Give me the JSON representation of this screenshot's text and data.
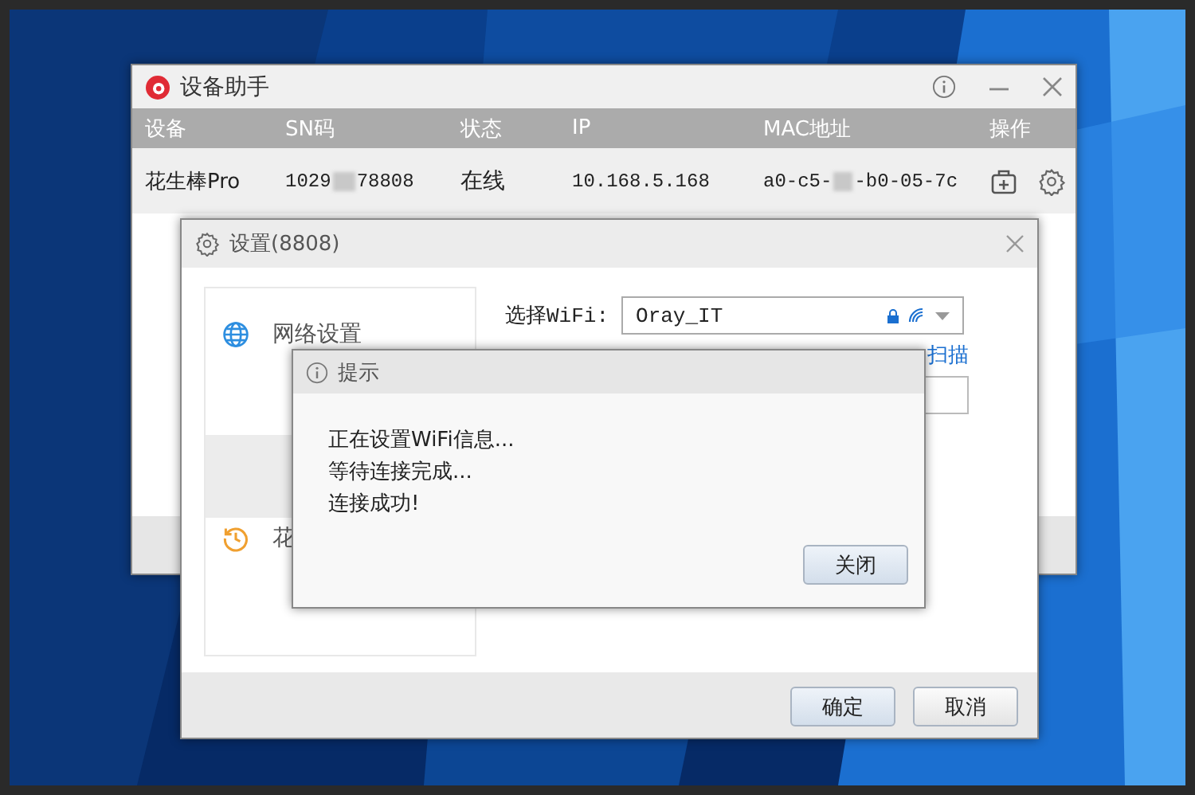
{
  "main_window": {
    "title": "设备助手",
    "columns": [
      "设备",
      "SN码",
      "状态",
      "IP",
      "MAC地址",
      "操作"
    ],
    "rows": [
      {
        "device": "花生棒Pro",
        "sn": [
          "1029",
          "78808"
        ],
        "status": "在线",
        "ip": "10.168.5.168",
        "mac": [
          "a0-c5-",
          "-b0-05-7c"
        ]
      }
    ]
  },
  "settings_window": {
    "title": "设置(8808)",
    "nav": [
      {
        "label": "网络设置",
        "selected": false
      },
      {
        "selected": true
      },
      {
        "label": "花",
        "selected": false
      }
    ],
    "wifi": {
      "label": "选择WiFi:",
      "value": "Oray_IT",
      "secured": true
    },
    "link": "扫描",
    "buttons": [
      {
        "label": "确定",
        "kind": "primary"
      },
      {
        "label": "取消",
        "kind": "secondary"
      }
    ]
  },
  "dialog": {
    "title": "提示",
    "lines": [
      "正在设置WiFi信息...",
      "等待连接完成...",
      "连接成功!"
    ],
    "button": "关闭"
  }
}
